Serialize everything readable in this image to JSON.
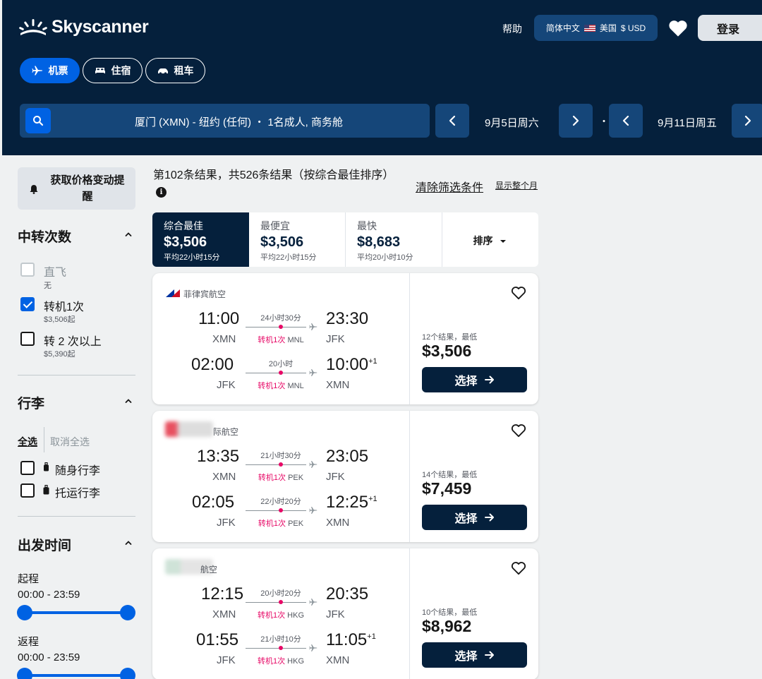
{
  "header": {
    "logo_text": "Skyscanner",
    "help": "帮助",
    "locale": {
      "language": "简体中文",
      "country": "美国",
      "currency": "$ USD"
    },
    "login": "登录",
    "mode_tabs": [
      {
        "label": "机票",
        "icon": "plane-icon",
        "active": true
      },
      {
        "label": "住宿",
        "icon": "bed-icon",
        "active": false
      },
      {
        "label": "租车",
        "icon": "car-icon",
        "active": false
      }
    ],
    "search_summary": "厦门 (XMN) - 纽约 (任何) ・ 1名成人, 商务舱",
    "depart_date": "9月5日周六",
    "return_date": "9月11日周五",
    "date_separator": "・"
  },
  "sidebar": {
    "price_alert": "获取价格变动提醒",
    "stops": {
      "title": "中转次数",
      "options": [
        {
          "label": "直飞",
          "sub": "无",
          "checked": false,
          "disabled": true
        },
        {
          "label": "转机1次",
          "sub": "$3,506起",
          "checked": true,
          "disabled": false
        },
        {
          "label": "转 2 次以上",
          "sub": "$5,390起",
          "checked": false,
          "disabled": false
        }
      ]
    },
    "baggage": {
      "title": "行李",
      "select_all": "全选",
      "deselect_all": "取消全选",
      "options": [
        {
          "label": "随身行李",
          "checked": false
        },
        {
          "label": "托运行李",
          "checked": false
        }
      ]
    },
    "departure_time": {
      "title": "出发时间",
      "outbound_label": "起程",
      "outbound_range": "00:00 - 23:59",
      "return_label": "返程",
      "return_range": "00:00 - 23:59"
    }
  },
  "results": {
    "summary": "第102条结果，共526条结果（按综合最佳排序）",
    "info_glyph": "i",
    "clear_filters": "清除筛选条件",
    "show_whole_month": "显示整个月",
    "sort_tabs": [
      {
        "label": "综合最佳",
        "price": "$3,506",
        "time": "平均22小时15分",
        "active": true
      },
      {
        "label": "最便宜",
        "price": "$3,506",
        "time": "平均22小时15分",
        "active": false
      },
      {
        "label": "最快",
        "price": "$8,683",
        "time": "平均20小时10分",
        "active": false
      }
    ],
    "sort_label": "排序",
    "select_label": "选择",
    "cards": [
      {
        "airline": "菲律宾航空",
        "legs": [
          {
            "dep_time": "11:00",
            "dep_code": "XMN",
            "duration": "24小时30分",
            "stops": "转机1次",
            "via": "MNL",
            "arr_time": "23:30",
            "arr_code": "JFK",
            "plus": ""
          },
          {
            "dep_time": "02:00",
            "dep_code": "JFK",
            "duration": "20小时",
            "stops": "转机1次",
            "via": "MNL",
            "arr_time": "10:00",
            "arr_code": "XMN",
            "plus": "+1"
          }
        ],
        "deal_count": "12个结果，最低",
        "price": "$3,506"
      },
      {
        "airline": "际航空",
        "legs": [
          {
            "dep_time": "13:35",
            "dep_code": "XMN",
            "duration": "21小时30分",
            "stops": "转机1次",
            "via": "PEK",
            "arr_time": "23:05",
            "arr_code": "JFK",
            "plus": ""
          },
          {
            "dep_time": "02:05",
            "dep_code": "JFK",
            "duration": "22小时20分",
            "stops": "转机1次",
            "via": "PEK",
            "arr_time": "12:25",
            "arr_code": "XMN",
            "plus": "+1"
          }
        ],
        "deal_count": "14个结果，最低",
        "price": "$7,459"
      },
      {
        "airline": "航空",
        "legs": [
          {
            "dep_time": "12:15",
            "dep_code": "XMN",
            "duration": "20小时20分",
            "stops": "转机1次",
            "via": "HKG",
            "arr_time": "20:35",
            "arr_code": "JFK",
            "plus": ""
          },
          {
            "dep_time": "01:55",
            "dep_code": "JFK",
            "duration": "21小时10分",
            "stops": "转机1次",
            "via": "HKG",
            "arr_time": "11:05",
            "arr_code": "XMN",
            "plus": "+1"
          }
        ],
        "deal_count": "10个结果，最低",
        "price": "$8,962"
      }
    ]
  },
  "colors": {
    "header_bg": "#05203c",
    "accent_blue": "#0062e3",
    "stop_pink": "#e70866",
    "search_bg": "#154679"
  }
}
